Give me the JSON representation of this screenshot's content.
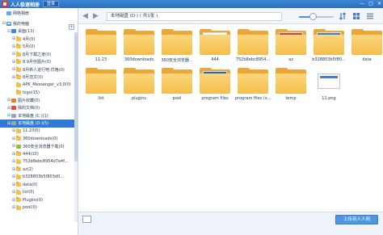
{
  "window": {
    "title": "人人极速相册",
    "login_label": "登录",
    "controls": [
      "—",
      "□",
      "✕"
    ]
  },
  "sidebar": {
    "items": [
      {
        "label": "网络相册",
        "icon": "network-icon",
        "expander": ""
      },
      {
        "label": "我的电脑",
        "icon": "computer-icon",
        "expander": "⊟"
      },
      {
        "label": "桌面(13)",
        "icon": "desktop-icon",
        "expander": "⊟"
      },
      {
        "label": "4月(0)",
        "icon": "folder-icon",
        "expander": "⊞"
      },
      {
        "label": "5月(0)",
        "icon": "folder-icon",
        "expander": "⊞"
      },
      {
        "label": "8月下载之家(0)",
        "icon": "folder-icon",
        "expander": "⊞"
      },
      {
        "label": "8.9月份图片(0)",
        "icon": "folder-icon",
        "expander": "⊞"
      },
      {
        "label": "8月新人进行吧.优格(0)",
        "icon": "folder-icon",
        "expander": "⊞"
      },
      {
        "label": "8月范文(0)",
        "icon": "folder-icon",
        "expander": "⊞"
      },
      {
        "label": "APK_Messenger_v3.0(0)",
        "icon": "folder-icon",
        "expander": ""
      },
      {
        "label": "logo(15)",
        "icon": "folder-icon",
        "expander": ""
      },
      {
        "label": "图片收藏(0)",
        "icon": "image-icon",
        "expander": "⊞"
      },
      {
        "label": "我的文档(0)",
        "icon": "document-icon",
        "expander": "⊞"
      },
      {
        "label": "本地磁盘 (C:)(1)",
        "icon": "drive-icon",
        "expander": "⊞"
      },
      {
        "label": "本地磁盘 (D:)(5)",
        "icon": "drive-icon",
        "expander": "⊟",
        "selected": true
      },
      {
        "label": "11.23(0)",
        "icon": "folder-icon",
        "expander": "⊞"
      },
      {
        "label": "360downloads(0)",
        "icon": "folder-icon",
        "expander": "⊞"
      },
      {
        "label": "360安全浏览器下载(0)",
        "icon": "download-folder-icon",
        "expander": "⊞"
      },
      {
        "label": "444(10)",
        "icon": "folder-icon",
        "expander": "⊞"
      },
      {
        "label": "752b8ebc8954d7e4f...",
        "icon": "folder-icon",
        "expander": "⊞"
      },
      {
        "label": "az(2)",
        "icon": "folder-icon",
        "expander": "⊞"
      },
      {
        "label": "b328803b5f803d0...",
        "icon": "folder-icon",
        "expander": "⊞"
      },
      {
        "label": "data(0)",
        "icon": "folder-icon",
        "expander": "⊞"
      },
      {
        "label": "list(0)",
        "icon": "folder-icon",
        "expander": "⊞"
      },
      {
        "label": "Plugins(0)",
        "icon": "folder-icon",
        "expander": "⊞"
      },
      {
        "label": "pool(0)",
        "icon": "folder-icon",
        "expander": "⊞"
      }
    ]
  },
  "toolbar": {
    "back_icon": "arrow-left-icon",
    "forward_icon": "arrow-right-icon",
    "path": "本地磁盘 (D:) ( 共1张 )",
    "zoom_level": 0.4
  },
  "files": [
    {
      "name": "11.23",
      "type": "folder",
      "preview": "empty"
    },
    {
      "name": "360downloads",
      "type": "folder",
      "preview": "empty"
    },
    {
      "name": "360安全浏览器...",
      "type": "folder",
      "preview": "empty"
    },
    {
      "name": "444",
      "type": "folder",
      "preview": "screenshot"
    },
    {
      "name": "752b8ebc8954...",
      "type": "folder",
      "preview": "empty"
    },
    {
      "name": "az",
      "type": "folder",
      "preview": "red"
    },
    {
      "name": "b328803b5f80...",
      "type": "folder",
      "preview": "blue"
    },
    {
      "name": "data",
      "type": "folder",
      "preview": "empty"
    },
    {
      "name": "list",
      "type": "folder",
      "preview": "empty"
    },
    {
      "name": "plugins",
      "type": "folder",
      "preview": "empty"
    },
    {
      "name": "pool",
      "type": "folder",
      "preview": "empty"
    },
    {
      "name": "program files",
      "type": "folder",
      "preview": "doc"
    },
    {
      "name": "program files (x...",
      "type": "folder",
      "preview": "empty"
    },
    {
      "name": "temp",
      "type": "folder",
      "preview": "empty"
    },
    {
      "name": "11.png",
      "type": "image",
      "preview": "png"
    }
  ],
  "bottombar": {
    "upload_label": "上传到人人网"
  }
}
